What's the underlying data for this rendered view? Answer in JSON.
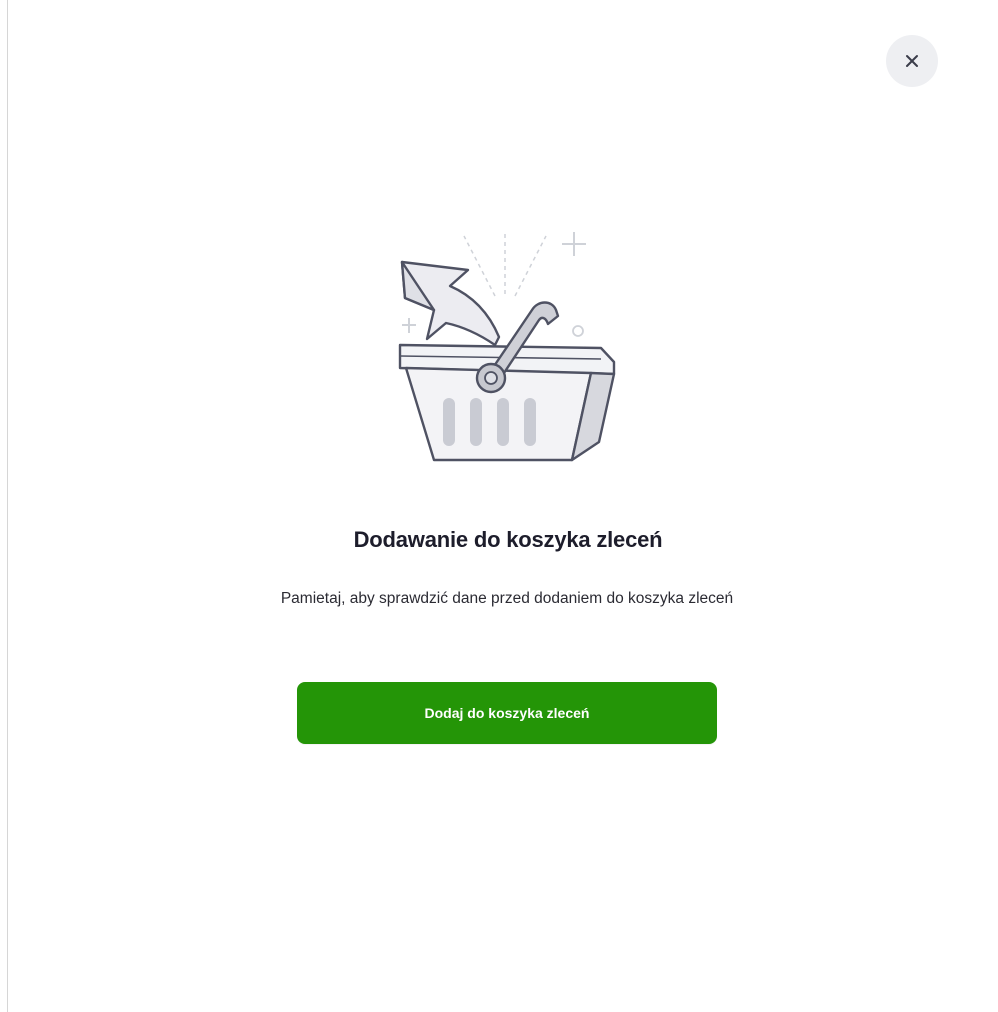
{
  "dialog": {
    "close_icon": "close-icon",
    "illustration_icon": "shopping-basket-icon",
    "title": "Dodawanie do koszyka zleceń",
    "message": "Pamietaj, aby sprawdzić dane przed dodaniem do koszyka zleceń",
    "primary_button_label": "Dodaj do koszyka zleceń"
  },
  "colors": {
    "primary": "#249507",
    "close_button_bg": "#eeeff2",
    "title": "#1d1d2b",
    "text": "#2b2b33"
  }
}
